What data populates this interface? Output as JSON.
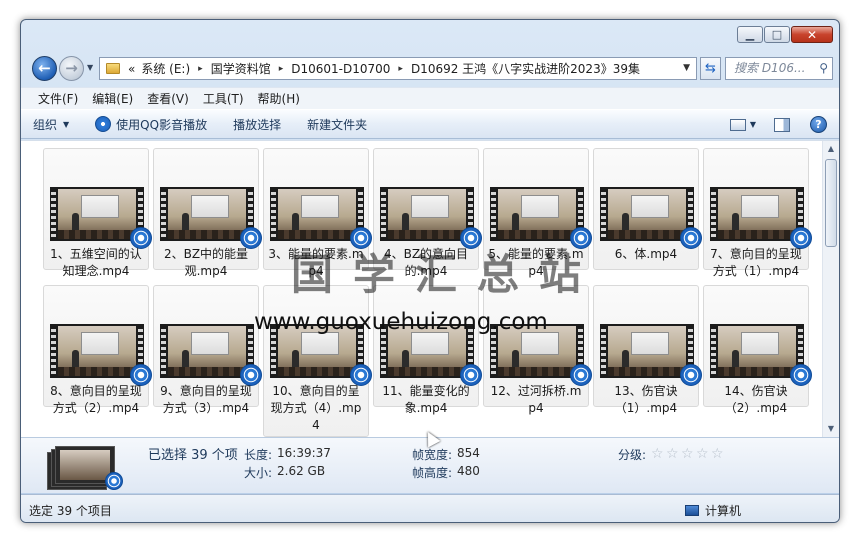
{
  "window": {
    "caption": {
      "minimize": "▁",
      "maximize": "□",
      "close": "✕"
    }
  },
  "address": {
    "prefix": "«",
    "breadcrumbs": [
      "系统 (E:)",
      "国学资料馆",
      "D10601-D10700",
      "D10692 王鸿《八字实战进阶2023》39集"
    ],
    "separator": "▸",
    "search_placeholder": "搜索 D106...",
    "icons": [
      "back-arrow-icon",
      "forward-arrow-icon",
      "refresh-icon",
      "search-icon"
    ]
  },
  "menu": [
    "文件(F)",
    "编辑(E)",
    "查看(V)",
    "工具(T)",
    "帮助(H)"
  ],
  "commands": {
    "organize": "组织",
    "play_qq": "使用QQ影音播放",
    "play_selection": "播放选择",
    "new_folder": "新建文件夹"
  },
  "files": [
    {
      "name": "1、五维空间的认知理念.mp4"
    },
    {
      "name": "2、BZ中的能量观.mp4"
    },
    {
      "name": "3、能量的要素.mp4"
    },
    {
      "name": "4、BZ的意向目的.mp4"
    },
    {
      "name": "5、能量的要素.mp4"
    },
    {
      "name": "6、体.mp4"
    },
    {
      "name": "7、意向目的呈现方式（1）.mp4"
    },
    {
      "name": "8、意向目的呈现方式（2）.mp4"
    },
    {
      "name": "9、意向目的呈现方式（3）.mp4"
    },
    {
      "name": "10、意向目的呈现方式（4）.mp4"
    },
    {
      "name": "11、能量变化的象.mp4"
    },
    {
      "name": "12、过河拆桥.mp4"
    },
    {
      "name": "13、伤官诀（1）.mp4"
    },
    {
      "name": "14、伤官诀（2）.mp4"
    }
  ],
  "watermark": {
    "title": "国学汇总站",
    "url": "www.guoxuehuizong.com"
  },
  "details": {
    "selected": "已选择 39 个项",
    "length_label": "长度:",
    "length": "16:39:37",
    "size_label": "大小:",
    "size": "2.62 GB",
    "width_label": "帧宽度:",
    "width": "854",
    "height_label": "帧高度:",
    "height": "480",
    "rating_label": "分级:",
    "rating": 0,
    "rating_max": 5
  },
  "status": {
    "left": "选定 39 个项目",
    "right": "计算机"
  },
  "colors": {
    "accent": "#2a78d4",
    "chrome": "#c6d9ee"
  }
}
